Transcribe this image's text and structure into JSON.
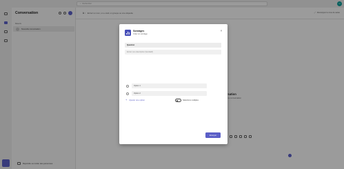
{
  "titlebar": {
    "search_placeholder": "Rechercher",
    "avatar_initials": "U"
  },
  "rail": {
    "items": [
      "Activité",
      "Conversation",
      "Teams",
      "Calendrier"
    ]
  },
  "list": {
    "title": "Conversation",
    "section_label": "Récents",
    "chat_item": "Nouvelle conversation",
    "invite_label": "Rejoindre ou inviter des personnes"
  },
  "main": {
    "header_to": "À :",
    "header_placeholder": "Entrez un nom, un e-mail, un groupe ou une étiquette",
    "header_right": "Développer la zone de saisie",
    "empty_title": "Conversation",
    "empty_sub": "Démarrer une conversation"
  },
  "dialog": {
    "title": "Sondages",
    "subtitle": "Créer un sondage",
    "close_glyph": "×",
    "question_label": "Question",
    "description_placeholder": "Entrez une description (facultatif)",
    "options": [
      "Option 1",
      "Option 2"
    ],
    "add_option_label": "Ajouter une option",
    "add_option_glyph": "+",
    "multiple_label": "Sélections multiples",
    "send_label": "Envoyer",
    "accent_color": "#5b5fc7",
    "icon_color": "#464eb8"
  }
}
